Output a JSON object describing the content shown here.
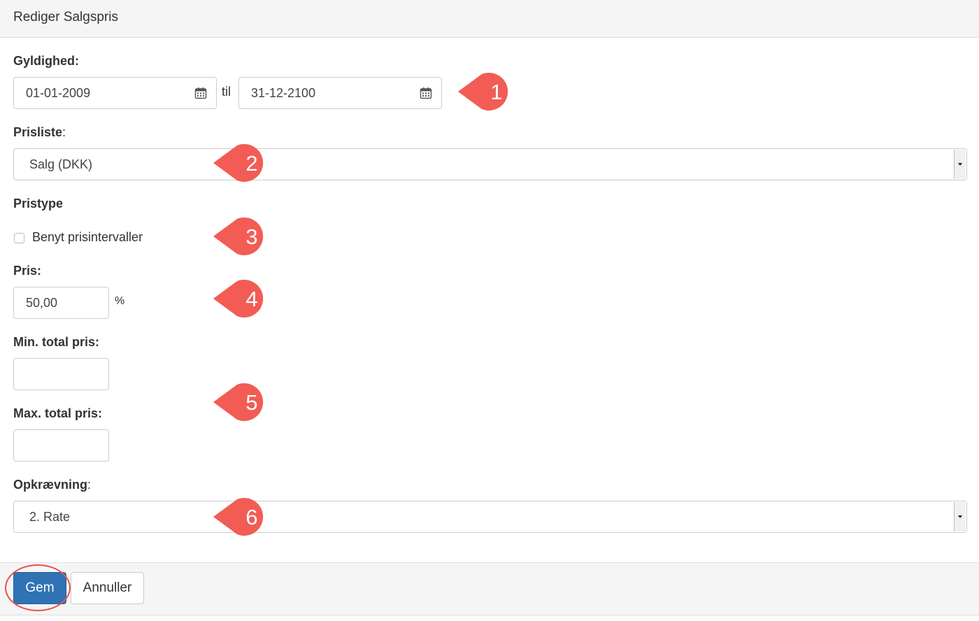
{
  "dialog": {
    "title": "Rediger Salgspris"
  },
  "validity": {
    "label": "Gyldighed:",
    "from_value": "01-01-2009",
    "separator": "til",
    "to_value": "31-12-2100"
  },
  "price_list": {
    "label": "Prisliste",
    "label_suffix": ":",
    "selected": "Salg (DKK)"
  },
  "price_type": {
    "label": "Pristype",
    "checkbox_label": "Benyt prisintervaller",
    "checked": false
  },
  "price": {
    "label": "Pris:",
    "value": "50,00",
    "unit": "%"
  },
  "min_total": {
    "label": "Min. total pris:",
    "value": ""
  },
  "max_total": {
    "label": "Max. total pris:",
    "value": ""
  },
  "charging": {
    "label": "Opkrævning",
    "label_suffix": ":",
    "selected": "2. Rate"
  },
  "footer": {
    "save_label": "Gem",
    "cancel_label": "Annuller"
  },
  "callouts": [
    "1",
    "2",
    "3",
    "4",
    "5",
    "6"
  ],
  "colors": {
    "callout": "#f25c54",
    "primary_button": "#2f73b5",
    "highlight_ring": "#e8534d"
  },
  "icons": {
    "date_picker": "calendar-icon",
    "select": "chevron-down-icon"
  }
}
